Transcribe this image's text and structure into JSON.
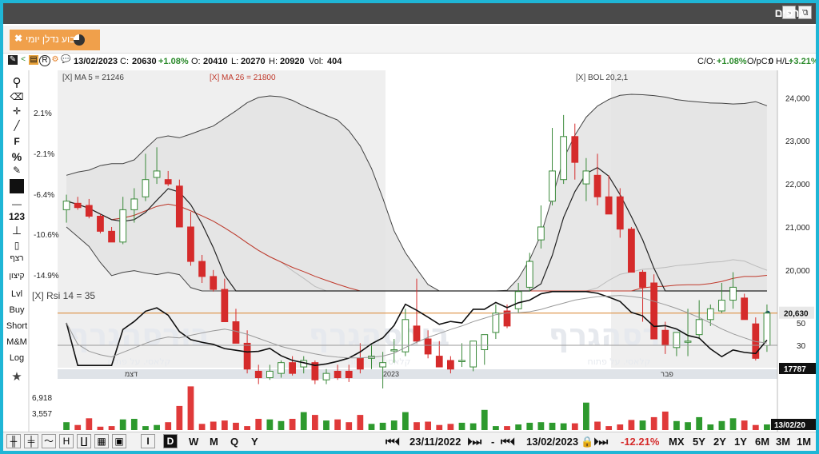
{
  "window": {
    "title": "גרפים",
    "minimize_icon": "–",
    "popout_icon": "⧉"
  },
  "tab": {
    "label": "רבוע נדלן יומי",
    "close": "✖"
  },
  "info": {
    "date": "13/02/2023",
    "close_label": "C:",
    "close_value": "20630",
    "change": "+1.08%",
    "open_label": "O:",
    "open_value": "20410",
    "low_label": "L:",
    "low_value": "20270",
    "high_label": "H:",
    "high_value": "20920",
    "vol_label": "Vol:",
    "vol_value": "404",
    "co_label": "C/O:",
    "co_value": "+1.08%",
    "opc_label": "O/pC:",
    "opc_value": "0",
    "hl_label": "H/L:",
    "hl_value": "+3.21%"
  },
  "left_toolbar": [
    "F",
    "%",
    "123",
    "רצף",
    "קיצון",
    "Lvl",
    "Buy",
    "Short",
    "M&M",
    "Log"
  ],
  "indicators": {
    "ma5": "[X] MA 5 = 21246",
    "ma26": "[X] MA 26 = 21800",
    "bol": "[X] BOL 20,2,1",
    "rsi": "[X] Rsi 14 = 35"
  },
  "price_axis": [
    "24,000",
    "23,000",
    "22,000",
    "21,000",
    "20,000"
  ],
  "price_tag": "20,630",
  "pct_axis": [
    "2.1%",
    "-2.1%",
    "-6.4%",
    "-10.6%",
    "-14.9%"
  ],
  "rsi_axis": [
    "50",
    "30"
  ],
  "date_labels": [
    "דצמ",
    "2023",
    "פבר"
  ],
  "volume_axis": [
    "6,918",
    "3,557"
  ],
  "volume_tag": "17787",
  "date_tag": "13/02/20",
  "watermark": "בורסהגרף",
  "watermark_sub": "קלאסי. על פתוח",
  "bottom": {
    "periods": [
      "I",
      "D",
      "W",
      "M",
      "Q",
      "Y"
    ],
    "selected_period": "D",
    "from_date": "23/11/2022",
    "dash": "-",
    "to_date": "13/02/2023",
    "range_change": "-12.21%",
    "ranges": [
      "MX",
      "5Y",
      "2Y",
      "1Y",
      "6M",
      "3M",
      "1M"
    ]
  },
  "chart_data": {
    "type": "candlestick",
    "ylim": [
      19700,
      24600
    ],
    "candles": [
      {
        "o": 21400,
        "h": 21750,
        "l": 21100,
        "c": 21600
      },
      {
        "o": 21550,
        "h": 21700,
        "l": 21400,
        "c": 21450
      },
      {
        "o": 21500,
        "h": 21650,
        "l": 21200,
        "c": 21250
      },
      {
        "o": 21250,
        "h": 21300,
        "l": 20850,
        "c": 20900
      },
      {
        "o": 20900,
        "h": 21000,
        "l": 20650,
        "c": 20650
      },
      {
        "o": 20650,
        "h": 21700,
        "l": 20600,
        "c": 21400
      },
      {
        "o": 21400,
        "h": 21900,
        "l": 21100,
        "c": 21650
      },
      {
        "o": 21700,
        "h": 22700,
        "l": 21600,
        "c": 22100
      },
      {
        "o": 22150,
        "h": 22850,
        "l": 22000,
        "c": 22300
      },
      {
        "o": 22100,
        "h": 22300,
        "l": 21950,
        "c": 22000
      },
      {
        "o": 21950,
        "h": 22100,
        "l": 21000,
        "c": 21000
      },
      {
        "o": 21000,
        "h": 21350,
        "l": 20100,
        "c": 20200
      },
      {
        "o": 20200,
        "h": 20350,
        "l": 19700,
        "c": 19850
      },
      {
        "o": 19850,
        "h": 20000,
        "l": 19500,
        "c": 19550
      },
      {
        "o": 19550,
        "h": 19800,
        "l": 18800,
        "c": 18800
      },
      {
        "o": 18800,
        "h": 19100,
        "l": 18300,
        "c": 18300
      },
      {
        "o": 18300,
        "h": 18600,
        "l": 17600,
        "c": 17700
      },
      {
        "o": 17650,
        "h": 17800,
        "l": 17350,
        "c": 17500
      },
      {
        "o": 17500,
        "h": 17800,
        "l": 17450,
        "c": 17650
      },
      {
        "o": 17600,
        "h": 17900,
        "l": 17500,
        "c": 17850
      },
      {
        "o": 17850,
        "h": 18000,
        "l": 17550,
        "c": 17600
      },
      {
        "o": 17750,
        "h": 18000,
        "l": 17600,
        "c": 17900
      },
      {
        "o": 17850,
        "h": 17900,
        "l": 17350,
        "c": 17450
      },
      {
        "o": 17450,
        "h": 17700,
        "l": 17350,
        "c": 17600
      },
      {
        "o": 17650,
        "h": 17800,
        "l": 17450,
        "c": 17500
      },
      {
        "o": 17650,
        "h": 17800,
        "l": 17400,
        "c": 17500
      },
      {
        "o": 17950,
        "h": 18300,
        "l": 17600,
        "c": 17700
      },
      {
        "o": 17950,
        "h": 18300,
        "l": 17700,
        "c": 18000
      },
      {
        "o": 17750,
        "h": 18100,
        "l": 17250,
        "c": 17850
      },
      {
        "o": 18150,
        "h": 18400,
        "l": 17850,
        "c": 18150
      },
      {
        "o": 18100,
        "h": 19100,
        "l": 18000,
        "c": 18850
      },
      {
        "o": 18700,
        "h": 19800,
        "l": 18300,
        "c": 18350
      },
      {
        "o": 18400,
        "h": 18600,
        "l": 17950,
        "c": 18050
      },
      {
        "o": 18000,
        "h": 18350,
        "l": 17750,
        "c": 17750
      },
      {
        "o": 17900,
        "h": 18000,
        "l": 17600,
        "c": 17700
      },
      {
        "o": 17900,
        "h": 18300,
        "l": 17750,
        "c": 17900
      },
      {
        "o": 17750,
        "h": 18300,
        "l": 17650,
        "c": 18350
      },
      {
        "o": 18150,
        "h": 18400,
        "l": 17800,
        "c": 18500
      },
      {
        "o": 18550,
        "h": 19200,
        "l": 18400,
        "c": 19000
      },
      {
        "o": 19050,
        "h": 19200,
        "l": 18650,
        "c": 18700
      },
      {
        "o": 19100,
        "h": 19700,
        "l": 19000,
        "c": 19500
      },
      {
        "o": 19600,
        "h": 20400,
        "l": 19500,
        "c": 20200
      },
      {
        "o": 20700,
        "h": 21500,
        "l": 20500,
        "c": 21000
      },
      {
        "o": 21600,
        "h": 23300,
        "l": 21500,
        "c": 22300
      },
      {
        "o": 22100,
        "h": 23600,
        "l": 22000,
        "c": 23100
      },
      {
        "o": 23100,
        "h": 23400,
        "l": 22100,
        "c": 22500
      },
      {
        "o": 22000,
        "h": 22600,
        "l": 21600,
        "c": 22300
      },
      {
        "o": 22200,
        "h": 22700,
        "l": 21500,
        "c": 21700
      },
      {
        "o": 21700,
        "h": 22200,
        "l": 21300,
        "c": 21300
      },
      {
        "o": 21700,
        "h": 21900,
        "l": 20750,
        "c": 20950
      },
      {
        "o": 20950,
        "h": 21000,
        "l": 19950,
        "c": 19950
      },
      {
        "o": 19950,
        "h": 20000,
        "l": 18800,
        "c": 19600
      },
      {
        "o": 19700,
        "h": 19900,
        "l": 18400,
        "c": 18400
      },
      {
        "o": 18600,
        "h": 18800,
        "l": 18050,
        "c": 18250
      },
      {
        "o": 18200,
        "h": 18550,
        "l": 18000,
        "c": 18550
      },
      {
        "o": 18350,
        "h": 19100,
        "l": 18000,
        "c": 18350
      },
      {
        "o": 18500,
        "h": 19300,
        "l": 18400,
        "c": 18850
      },
      {
        "o": 18850,
        "h": 19200,
        "l": 18700,
        "c": 19100
      },
      {
        "o": 19050,
        "h": 19700,
        "l": 19000,
        "c": 19300
      },
      {
        "o": 19300,
        "h": 19950,
        "l": 19100,
        "c": 19600
      },
      {
        "o": 19350,
        "h": 19450,
        "l": 18850,
        "c": 18850
      },
      {
        "o": 18750,
        "h": 18900,
        "l": 17900,
        "c": 17950
      },
      {
        "o": 18250,
        "h": 19200,
        "l": 18100,
        "c": 19000
      }
    ],
    "volumes": [
      1400,
      900,
      2100,
      600,
      700,
      1900,
      2000,
      700,
      900,
      1400,
      4300,
      7800,
      1100,
      1500,
      1700,
      1300,
      700,
      2000,
      1900,
      1600,
      2000,
      3200,
      2700,
      1700,
      1900,
      1400,
      2700,
      1100,
      1300,
      1700,
      3200,
      1400,
      1500,
      900,
      1100,
      1300,
      1200,
      3600,
      700,
      700,
      1000,
      1300,
      1400,
      1300,
      1200,
      1200,
      4900,
      1500,
      700,
      1000,
      1800,
      1700,
      2300,
      3300,
      1600,
      1400,
      2300,
      1000,
      1600,
      2100,
      1700,
      900,
      1000
    ],
    "volume_up": [
      true,
      false,
      false,
      false,
      false,
      true,
      true,
      true,
      true,
      false,
      false,
      false,
      false,
      false,
      false,
      false,
      false,
      false,
      true,
      true,
      false,
      true,
      false,
      true,
      false,
      false,
      false,
      true,
      true,
      true,
      true,
      false,
      false,
      false,
      false,
      true,
      true,
      true,
      true,
      false,
      true,
      true,
      true,
      true,
      true,
      false,
      true,
      false,
      false,
      false,
      false,
      true,
      false,
      false,
      true,
      true,
      true,
      true,
      true,
      true,
      false,
      false,
      true
    ]
  }
}
